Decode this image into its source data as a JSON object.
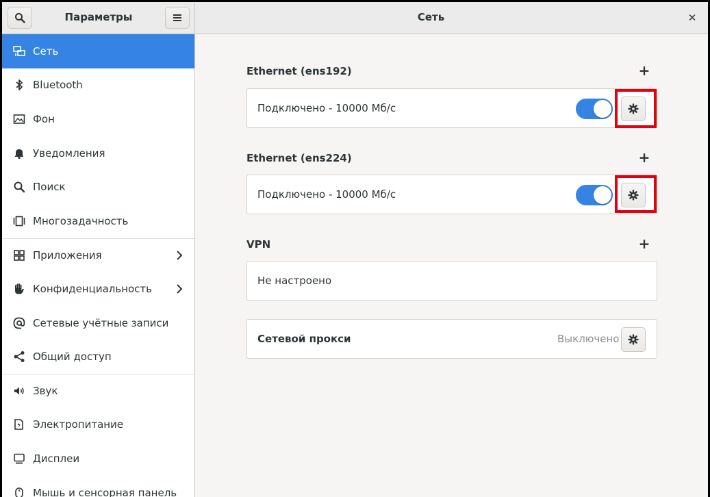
{
  "header": {
    "app_title": "Параметры",
    "page_title": "Сеть",
    "close_glyph": "✕"
  },
  "sidebar": {
    "items": [
      {
        "label": "Сеть",
        "icon": "network-icon",
        "active": true
      },
      {
        "label": "Bluetooth",
        "icon": "bluetooth-icon"
      },
      {
        "label": "Фон",
        "icon": "background-icon"
      },
      {
        "label": "Уведомления",
        "icon": "bell-icon"
      },
      {
        "label": "Поиск",
        "icon": "search-icon"
      },
      {
        "label": "Многозадачность",
        "icon": "multitasking-icon"
      },
      {
        "label": "Приложения",
        "icon": "apps-grid-icon",
        "has_submenu": true
      },
      {
        "label": "Конфиденциальность",
        "icon": "hand-icon",
        "has_submenu": true
      },
      {
        "label": "Сетевые учётные записи",
        "icon": "at-icon"
      },
      {
        "label": "Общий доступ",
        "icon": "share-icon"
      },
      {
        "label": "Звук",
        "icon": "speaker-icon"
      },
      {
        "label": "Электропитание",
        "icon": "power-icon"
      },
      {
        "label": "Дисплеи",
        "icon": "display-icon"
      },
      {
        "label": "Мышь и сенсорная панель",
        "icon": "mouse-icon"
      }
    ]
  },
  "main": {
    "ethernet1": {
      "title": "Ethernet (ens192)",
      "status": "Подключено - 10000 Мб/с",
      "enabled": true
    },
    "ethernet2": {
      "title": "Ethernet (ens224)",
      "status": "Подключено - 10000 Мб/с",
      "enabled": true
    },
    "vpn": {
      "title": "VPN",
      "status": "Не настроено"
    },
    "proxy": {
      "label": "Сетевой прокси",
      "status": "Выключено"
    },
    "add_glyph": "+"
  },
  "colors": {
    "accent": "#3584e4",
    "highlight": "#e3000f"
  }
}
